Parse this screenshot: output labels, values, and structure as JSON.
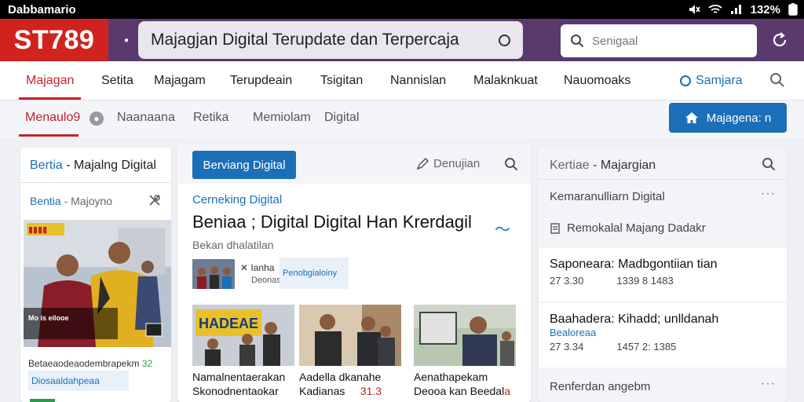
{
  "status": {
    "left": "Dabbamario",
    "right": "132%"
  },
  "header": {
    "logo": "ST789",
    "title": "Majagjan Digital Terupdate dan Terpercaja",
    "search_placeholder": "Senigaal",
    "colors": {
      "brand": "#d1231e",
      "bar": "#5a3a6e",
      "accent": "#1b6fb8"
    }
  },
  "nav": {
    "items": [
      "Majagan",
      "Setita",
      "Majagam",
      "Terupdeain",
      "Tsigitan",
      "Nannislan",
      "Malaknkuat",
      "Nauomoaks"
    ],
    "login": "Samjara"
  },
  "subnav": {
    "items": [
      "Menaulo9",
      "Naanaana",
      "Retika",
      "Memiolam",
      "Digital"
    ],
    "button": "Majagena: n"
  },
  "left": {
    "heading_blue": "Bertia",
    "heading_rest": " - Majalng Digital",
    "sub_blue": "Bentia",
    "sub_rest": " - Majoyno",
    "img_overlay": "Mo is eilooe",
    "caption": "Betaeaodeaodembrapekm",
    "caption_num": "32",
    "chip": "Diosaaldahpeaa"
  },
  "mid": {
    "tab": "Berviang Digital",
    "write": "Denujian",
    "category": "Cerneking Digital",
    "title": "Beniaa ; Digital Digital Han Krerdagil",
    "subtitle": "Bekan dhalatilan",
    "byline": "Ianha",
    "byline2": "Deonasa",
    "chip": "Penobgialoiny",
    "tiles": [
      {
        "banner": "HADEAE",
        "cap1": "Namalnentaerakan",
        "cap2": "Skonodnentaokar"
      },
      {
        "cap1": "Aadella dkanahe",
        "cap2": "Kadianas",
        "cap_red": "31.3"
      },
      {
        "cap1": "Aenathapekam",
        "cap2": "Deooa kan Beedal",
        "cap_red": "a"
      }
    ]
  },
  "right": {
    "heading_gray": "Kertiae",
    "heading_rest": " - Majargian",
    "line1": "Kemaranulliarn Digital",
    "line2": "Remokalal Majang Dadakr",
    "item1": {
      "title": "Saponeara: Madbgontiian tian",
      "a": "27 3.30",
      "b": "1339 8 1483"
    },
    "item2": {
      "title": "Baahadera: Kihadd; unlldanah",
      "sub": "Bealoreaa",
      "a": "27 3.34",
      "b": "1457 2: 1385"
    },
    "footer": "Renferdan angebm"
  }
}
